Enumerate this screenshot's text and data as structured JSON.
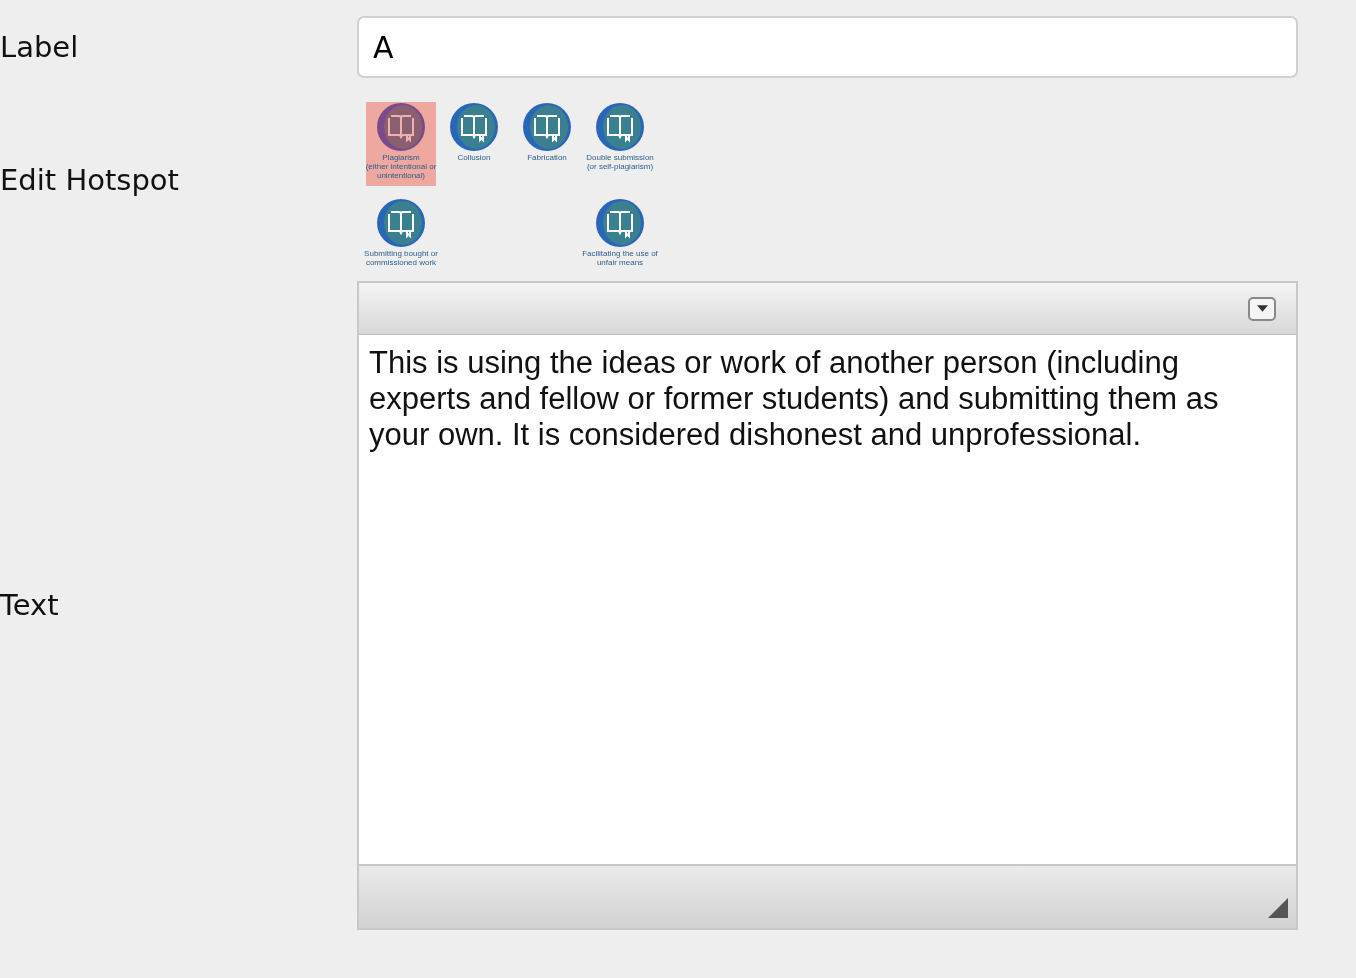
{
  "label_field": {
    "label": "Label",
    "value": "A"
  },
  "hotspot": {
    "label": "Edit Hotspot",
    "rows": [
      [
        {
          "kind": "item",
          "text": "Plagiarism\n(either intentional or\nunintentional)",
          "selected": true
        },
        {
          "kind": "item",
          "text": "Collusion",
          "selected": false
        },
        {
          "kind": "item",
          "text": "Fabrication",
          "selected": false
        },
        {
          "kind": "item",
          "text": "Double submission\n(or self-plagiarism)",
          "selected": false
        }
      ],
      [
        {
          "kind": "item",
          "text": "Submitting bought or\ncommissioned work",
          "selected": false
        },
        {
          "kind": "gap"
        },
        {
          "kind": "gap"
        },
        {
          "kind": "item",
          "text": "Facilitating the use of\nunfair means",
          "selected": false
        }
      ]
    ]
  },
  "text_field": {
    "label": "Text",
    "value": "This is using the ideas or work of another person (including experts and fellow or former students) and submitting them as your own. It is considered dishonest and unprofessional."
  }
}
